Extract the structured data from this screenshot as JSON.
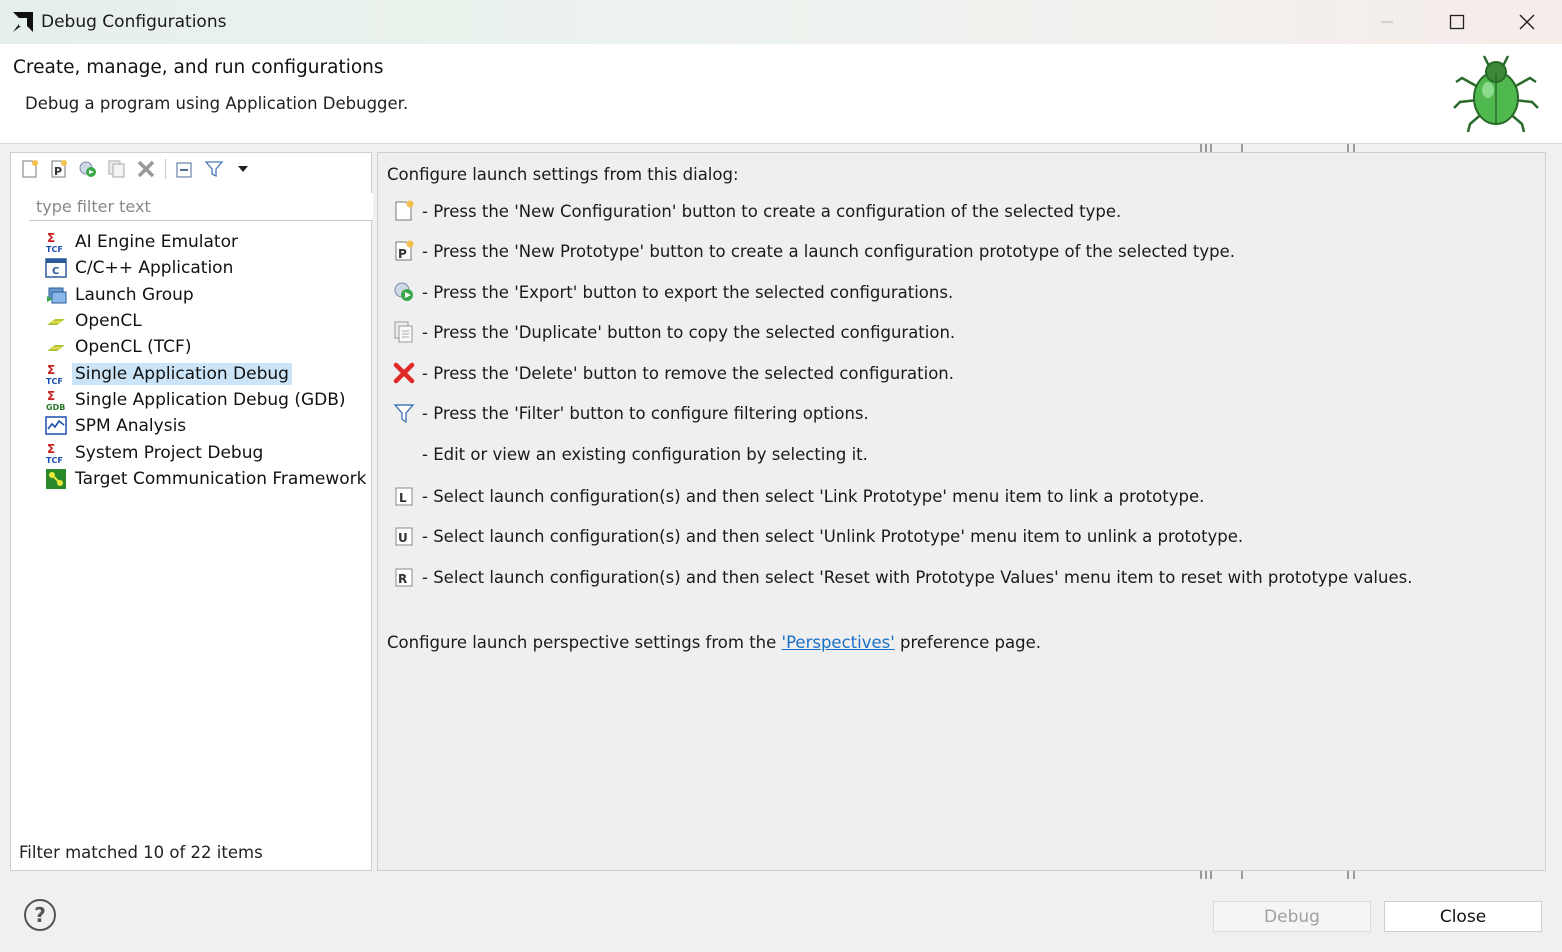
{
  "window": {
    "title": "Debug Configurations"
  },
  "banner": {
    "title": "Create, manage, and run configurations",
    "subtitle": "Debug a program using Application Debugger."
  },
  "left": {
    "toolbar": [
      {
        "name": "new-configuration-button",
        "icon": "new-config-icon"
      },
      {
        "name": "new-prototype-button",
        "icon": "new-prototype-icon"
      },
      {
        "name": "export-button",
        "icon": "export-icon"
      },
      {
        "name": "duplicate-button",
        "icon": "duplicate-icon"
      },
      {
        "name": "delete-button",
        "icon": "delete-icon"
      },
      {
        "name": "collapse-all-button",
        "icon": "collapse-icon"
      },
      {
        "name": "filter-button",
        "icon": "filter-icon"
      },
      {
        "name": "view-menu-button",
        "icon": "dropdown-arrow-icon"
      }
    ],
    "filter_placeholder": "type filter text",
    "tree_items": [
      {
        "label": "AI Engine Emulator",
        "icon": "tcf-icon"
      },
      {
        "label": "C/C++ Application",
        "icon": "c-app-icon"
      },
      {
        "label": "Launch Group",
        "icon": "launch-group-icon"
      },
      {
        "label": "OpenCL",
        "icon": "opencl-icon"
      },
      {
        "label": "OpenCL (TCF)",
        "icon": "opencl-icon"
      },
      {
        "label": "Single Application Debug",
        "icon": "tcf-icon",
        "selected": true
      },
      {
        "label": "Single Application Debug (GDB)",
        "icon": "gdb-icon"
      },
      {
        "label": "SPM Analysis",
        "icon": "spm-icon"
      },
      {
        "label": "System Project Debug",
        "icon": "tcf-icon"
      },
      {
        "label": "Target Communication Framework",
        "icon": "tcf-framework-icon"
      }
    ],
    "status": "Filter matched 10 of 22 items"
  },
  "right": {
    "intro": "Configure launch settings from this dialog:",
    "lines": [
      {
        "icon": "new-config-icon",
        "text": "- Press the 'New Configuration' button to create a configuration of the selected type."
      },
      {
        "icon": "new-prototype-icon",
        "text": "- Press the 'New Prototype' button to create a launch configuration prototype of the selected type."
      },
      {
        "icon": "export-icon",
        "text": "- Press the 'Export' button to export the selected configurations."
      },
      {
        "icon": "duplicate-icon",
        "text": "- Press the 'Duplicate' button to copy the selected configuration."
      },
      {
        "icon": "delete-icon",
        "text": "- Press the 'Delete' button to remove the selected configuration."
      },
      {
        "icon": "filter-icon",
        "text": "- Press the 'Filter' button to configure filtering options."
      },
      {
        "icon": "",
        "text": "- Edit or view an existing configuration by selecting it."
      },
      {
        "icon": "link-prototype-icon",
        "text": "- Select launch configuration(s) and then select 'Link Prototype' menu item to link a prototype."
      },
      {
        "icon": "unlink-prototype-icon",
        "text": "- Select launch configuration(s) and then select 'Unlink Prototype' menu item to unlink a prototype."
      },
      {
        "icon": "reset-prototype-icon",
        "text": "- Select launch configuration(s) and then select 'Reset with Prototype Values' menu item to reset with prototype values."
      }
    ],
    "footer_prefix": "Configure launch perspective settings from the ",
    "footer_link": "'Perspectives'",
    "footer_suffix": " preference page."
  },
  "buttons": {
    "debug": "Debug",
    "close": "Close",
    "help": "?"
  },
  "colors": {
    "selection": "#cce4f7",
    "link": "#1a6fc9",
    "delete_red": "#e02828"
  }
}
